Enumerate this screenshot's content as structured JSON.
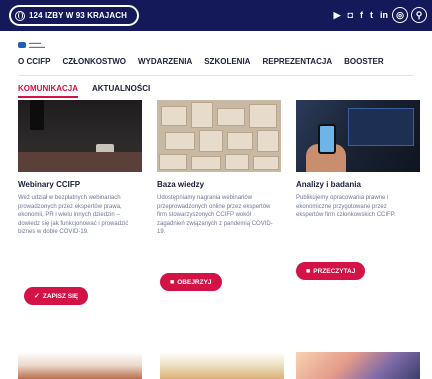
{
  "topbar": {
    "badge_label": "124 IZBY W 93 KRAJACH",
    "social_icons": [
      "youtube-icon",
      "instagram-icon",
      "facebook-icon",
      "twitter-icon",
      "linkedin-icon"
    ],
    "social_glyphs": [
      "▶",
      "◘",
      "f",
      "t",
      "in"
    ],
    "lang_icon": "globe-icon",
    "search_icon": "search-icon"
  },
  "nav": {
    "primary": [
      "O CCIFP",
      "CZŁONKOSTWO",
      "WYDARZENIA",
      "SZKOLENIA",
      "REPREZENTACJA",
      "BOOSTER"
    ],
    "secondary": [
      "KOMUNIKACJA",
      "AKTUALNOŚCI"
    ]
  },
  "cards": [
    {
      "title": "Webinary CCIFP",
      "text": "Weź udział w bezpłatnych webinariach prowadzonych przez ekspertów prawa, ekonomii, PR i wielu innych dziedzin – dowiedz się jak funkcjonować i prowadzić biznes w dobie COVID-19.",
      "button": "ZAPISZ SIĘ",
      "button_icon": "✓"
    },
    {
      "title": "Baza wiedzy",
      "text": "Udostępniamy nagrania webinariów przeprowadzonych online przez ekspertów firm stowarzyszonych CCIFP wokół zagadnień związanych z pandemią COVID-19.",
      "button": "OBEJRZYJ",
      "button_icon": "■"
    },
    {
      "title": "Analizy i badania",
      "text": "Publikujemy opracowania prawne i ekonomiczne przygotowane przez ekspertów firm członkowskich CCIFP.",
      "button": "PRZECZYTAJ",
      "button_icon": "■"
    }
  ],
  "colors": {
    "navy": "#14195a",
    "accent": "#d31245"
  }
}
